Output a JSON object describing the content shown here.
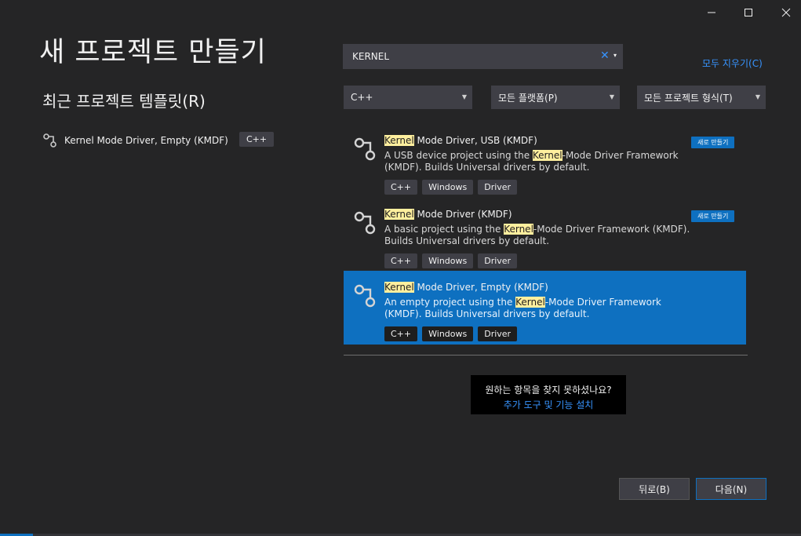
{
  "window": {
    "minimize_icon": "minimize-icon",
    "maximize_icon": "maximize-icon",
    "close_icon": "close-icon"
  },
  "title": "새 프로젝트 만들기",
  "recent": {
    "heading": "최근 프로젝트 템플릿(R)",
    "items": [
      {
        "name": "Kernel Mode Driver, Empty (KMDF)",
        "language": "C++",
        "icon": "driver-template-icon"
      }
    ]
  },
  "search": {
    "value": "KERNEL",
    "clear_glyph": "✕",
    "dropdown_glyph": "▾"
  },
  "clear_all": "모두 지우기(C)",
  "filters": {
    "language": "C++",
    "platform": "모든 플랫폼(P)",
    "project_type": "모든 프로젝트 형식(T)"
  },
  "highlight_term": "Kernel",
  "templates": [
    {
      "name_rest": " Mode Driver, USB (KMDF)",
      "desc_before": "A USB device project using the ",
      "desc_after": "-Mode Driver Framework (KMDF). Builds Universal drivers by default.",
      "tags": [
        "C++",
        "Windows",
        "Driver"
      ],
      "badge": "새로 만들기",
      "selected": false
    },
    {
      "name_rest": " Mode Driver (KMDF)",
      "desc_before": "A basic project using the ",
      "desc_after": "-Mode Driver Framework (KMDF). Builds Universal drivers by default.",
      "tags": [
        "C++",
        "Windows",
        "Driver"
      ],
      "badge": "새로 만들기",
      "selected": false
    },
    {
      "name_rest": " Mode Driver, Empty (KMDF)",
      "desc_before": "An empty project using the ",
      "desc_after": "-Mode Driver Framework (KMDF). Builds Universal drivers by default.",
      "tags": [
        "C++",
        "Windows",
        "Driver"
      ],
      "badge": "",
      "selected": true
    }
  ],
  "not_found": {
    "question": "원하는 항목을 찾지 못하셨나요?",
    "link": "추가 도구 및 기능 설치"
  },
  "buttons": {
    "back": "뒤로(B)",
    "next": "다음(N)"
  },
  "colors": {
    "background": "#252526",
    "accent": "#0e70c0",
    "link": "#3794ff",
    "highlight": "#ffef9e"
  }
}
